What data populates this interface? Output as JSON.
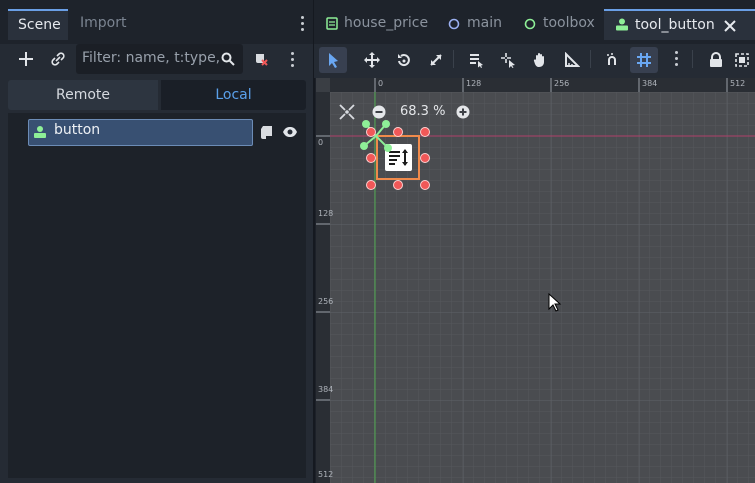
{
  "scene_dock": {
    "tabs": [
      {
        "label": "Scene",
        "active": true
      },
      {
        "label": "Import",
        "active": false
      }
    ],
    "filter_placeholder": "Filter: name, t:type,",
    "segments": [
      {
        "label": "Remote",
        "active": false
      },
      {
        "label": "Local",
        "active": true
      }
    ],
    "tree": [
      {
        "label": "button",
        "selected": true
      }
    ]
  },
  "editor_tabs": [
    {
      "label": "house_price",
      "icon": "script-icon",
      "active": false
    },
    {
      "label": "main",
      "icon": "scene-circle-icon",
      "active": false
    },
    {
      "label": "toolbox",
      "icon": "scene-circle-icon",
      "active": false
    },
    {
      "label": "tool_button",
      "icon": "control-node-icon",
      "active": true
    }
  ],
  "toolbar": {
    "tools": [
      "select-tool",
      "move-tool",
      "rotate-tool",
      "scale-tool",
      "list-select-tool",
      "pivot-tool",
      "pan-tool",
      "ruler-tool",
      "smart-snap-tool",
      "grid-snap-tool",
      "more-tool",
      "lock-tool",
      "group-tool"
    ]
  },
  "viewport": {
    "zoom_label": "68.3 %",
    "ruler_h": [
      "0",
      "128",
      "256",
      "384",
      "512"
    ],
    "ruler_v": [
      "0",
      "128",
      "256",
      "384",
      "512"
    ]
  },
  "colors": {
    "accent": "#6a9fe6",
    "local_text": "#5aa0ea",
    "node_green": "#8eef97",
    "selection_orange": "#f08a4b",
    "handle_red": "#f05858"
  }
}
